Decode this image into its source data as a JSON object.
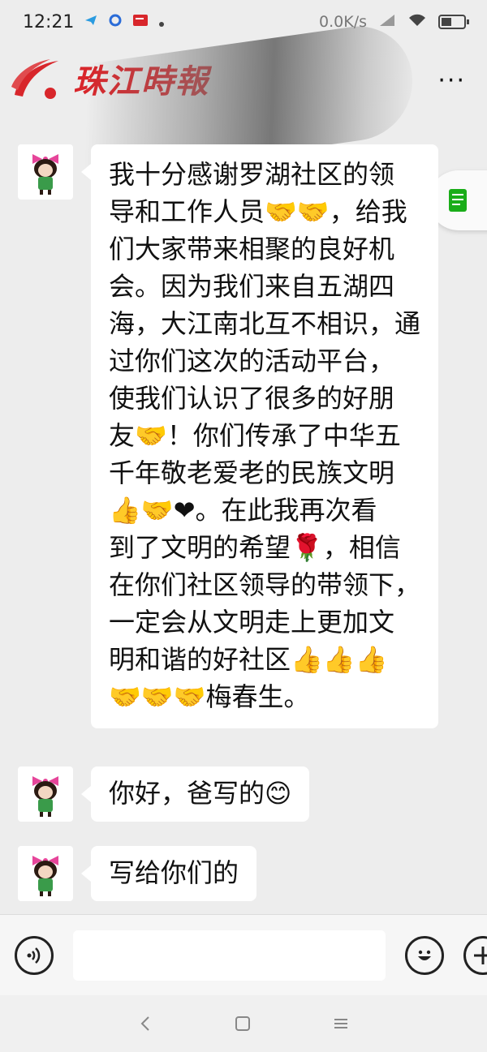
{
  "status_bar": {
    "time": "12:21",
    "speed": "0.0K/s"
  },
  "header": {
    "logo_text": "珠江時報",
    "more_label": "···"
  },
  "messages": [
    {
      "lines": [
        "我十分感谢罗湖社区的领",
        "导和工作人员🤝🤝，给我",
        "们大家带来相聚的良好机",
        "会。因为我们来自五湖四",
        "海，大江南北互不相识，通",
        "过你们这次的活动平台，",
        "使我们认识了很多的好朋",
        "友🤝！你们传承了中华五",
        "千年敬老爱老的民族文明",
        "👍🤝❤。在此我再次看",
        "到了文明的希望🌹，相信",
        "在你们社区领导的带领下，",
        "一定会从文明走上更加文",
        "明和谐的好社区👍👍👍",
        "🤝🤝🤝梅春生。"
      ]
    },
    {
      "lines": [
        "你好，爸写的😊"
      ]
    },
    {
      "lines": [
        "写给你们的"
      ]
    }
  ],
  "input": {
    "value": "",
    "placeholder": ""
  },
  "icons": {
    "voice": "voice-icon",
    "emoji": "emoji-icon",
    "add": "add-icon",
    "note": "note-icon",
    "back": "back-nav-icon",
    "home": "home-nav-icon",
    "menu": "menu-nav-icon"
  },
  "colors": {
    "logo_red": "#d8262b",
    "background": "#ededed",
    "bubble": "#ffffff",
    "note_green": "#1aad19"
  }
}
